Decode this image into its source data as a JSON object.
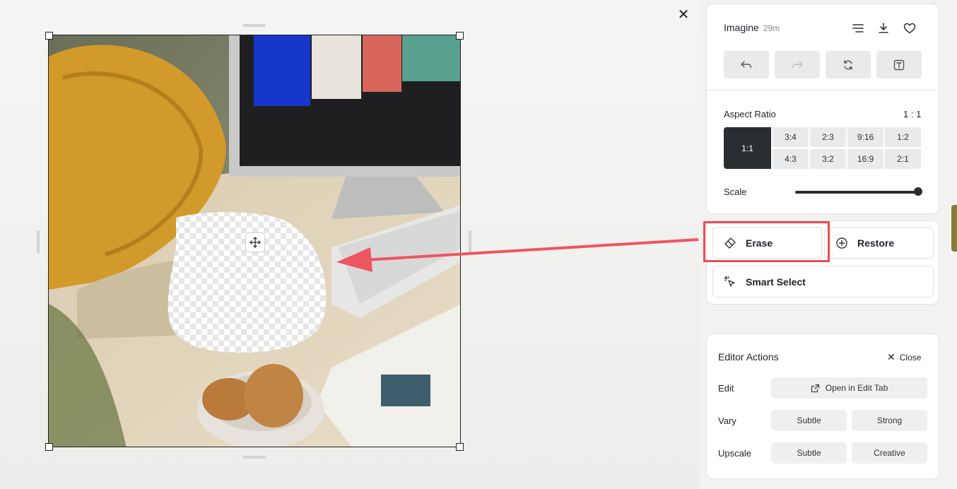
{
  "header": {
    "title": "Imagine",
    "age": "29m"
  },
  "aspect": {
    "label": "Aspect Ratio",
    "current": "1 : 1",
    "selected": "1:1",
    "top_row": [
      "3:4",
      "2:3",
      "9:16",
      "1:2"
    ],
    "bottom_row": [
      "4:3",
      "3:2",
      "16:9",
      "2:1"
    ]
  },
  "scale": {
    "label": "Scale",
    "value": 1.0
  },
  "tools": {
    "erase": "Erase",
    "restore": "Restore",
    "smart_select": "Smart Select"
  },
  "editor": {
    "title": "Editor Actions",
    "close": "Close",
    "edit_label": "Edit",
    "open_edit_tab": "Open in Edit Tab",
    "vary_label": "Vary",
    "vary_subtle": "Subtle",
    "vary_strong": "Strong",
    "upscale_label": "Upscale",
    "upscale_subtle": "Subtle",
    "upscale_creative": "Creative"
  },
  "colors": {
    "accent_dark": "#2a2e33",
    "highlight": "#ee4b55"
  }
}
